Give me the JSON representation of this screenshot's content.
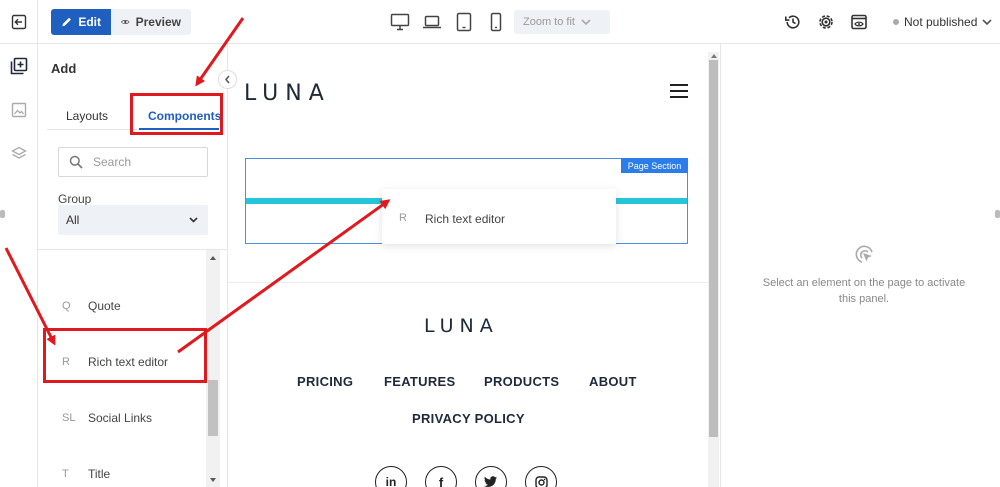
{
  "toolbar": {
    "edit_label": "Edit",
    "preview_label": "Preview",
    "zoom_label": "Zoom to fit",
    "status_label": "Not published"
  },
  "panel": {
    "title": "Add",
    "tabs": [
      {
        "label": "Layouts",
        "active": false
      },
      {
        "label": "Components",
        "active": true
      }
    ],
    "search_placeholder": "Search",
    "group_label": "Group",
    "group_value": "All",
    "items": [
      {
        "key": "Q",
        "label": "Quote"
      },
      {
        "key": "R",
        "label": "Rich text editor"
      },
      {
        "key": "SL",
        "label": "Social Links"
      },
      {
        "key": "T",
        "label": "Title"
      }
    ]
  },
  "canvas": {
    "logo": "LUNA",
    "section_tag": "Page Section",
    "drag_item": {
      "key": "R",
      "label": "Rich text editor"
    },
    "footer_logo": "LUNA",
    "footer_links": [
      "PRICING",
      "FEATURES",
      "PRODUCTS",
      "ABOUT",
      "PRIVACY POLICY"
    ],
    "social_icons": [
      "linkedin-icon",
      "facebook-icon",
      "twitter-icon",
      "instagram-icon"
    ],
    "social_labels": [
      "in",
      "f",
      "t",
      "ig"
    ]
  },
  "right_panel": {
    "message": "Select an element on the page to activate this panel."
  },
  "colors": {
    "accent": "#1f5fbf",
    "section_border": "#4a90e2",
    "drop_indicator": "#26c6da",
    "annotation": "#e0191e"
  }
}
